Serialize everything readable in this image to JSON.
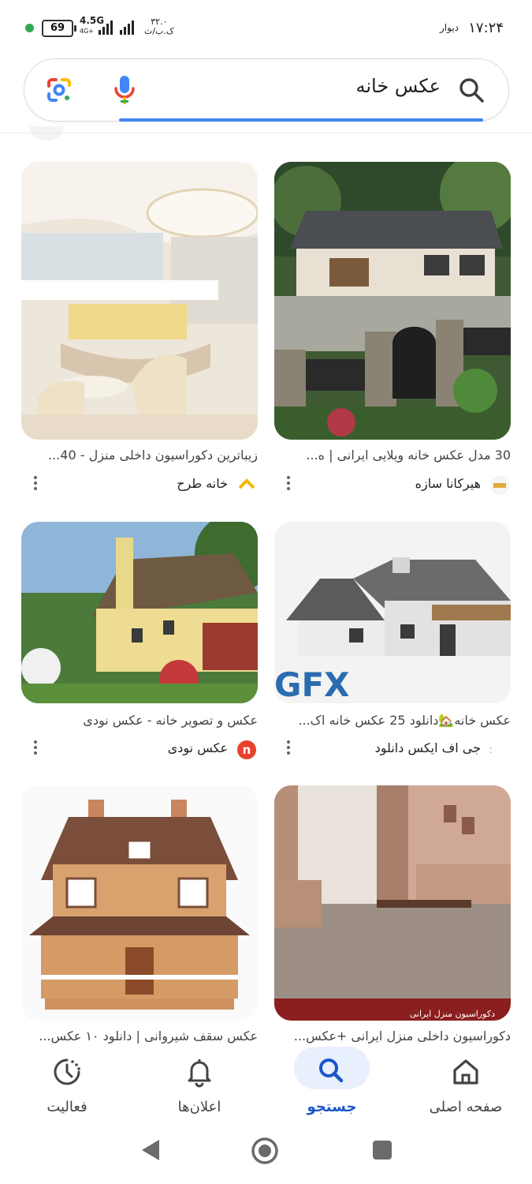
{
  "status_bar": {
    "time": "۱۷:۲۴",
    "label": "دیوار",
    "battery": "69",
    "network": "4.5G",
    "network_sub": "4G+",
    "speed_value": "۳۲.۰",
    "speed_unit": "ک.ب/ث"
  },
  "search": {
    "query": "عکس خانه"
  },
  "results": [
    {
      "title": "30 مدل عکس خانه ویلایی ایرانی | ه...",
      "source": "هیرکانا سازه",
      "logo": "hirkana-logo"
    },
    {
      "title": "زیباترین دکوراسیون داخلی منزل - 40...",
      "source": "خانه طرح",
      "logo": "khanetarh-logo"
    },
    {
      "title": "عکس خانه🏡دانلود 25 عکس خانه اک...",
      "source": "جی اف ایکس دانلود",
      "logo": "gfx-logo",
      "watermark": "GFX"
    },
    {
      "title": "عکس و تصویر خانه - عکس نودی",
      "source": "عکس نودی",
      "logo": "nodi-logo",
      "logo_letter": "n"
    },
    {
      "title": "دکوراسیون داخلی منزل ایرانی +عکس...",
      "source": "",
      "watermark": "دکوراسیون منزل ایرانی"
    },
    {
      "title": "عکس سقف شیروانی | دانلود ۱۰ عکس...",
      "source": ""
    }
  ],
  "bottom_nav": {
    "items": [
      {
        "label": "صفحه اصلی",
        "icon": "home-icon"
      },
      {
        "label": "جستجو",
        "icon": "search-icon",
        "active": true
      },
      {
        "label": "اعلان‌ها",
        "icon": "bell-icon"
      },
      {
        "label": "فعالیت",
        "icon": "activity-icon"
      }
    ]
  },
  "colors": {
    "accent": "#1a56c8",
    "underline": "#4285f4",
    "active_pill": "#e8f0fe"
  }
}
